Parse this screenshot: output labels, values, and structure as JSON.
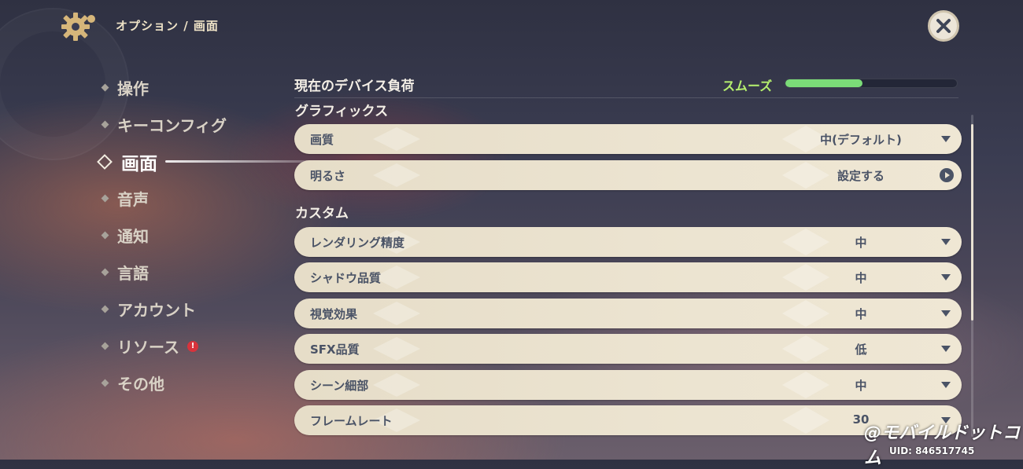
{
  "header": {
    "breadcrumb": "オプション / 画面",
    "settings_icon": "gear-icon",
    "close_icon": "close-icon"
  },
  "sidebar": {
    "items": [
      {
        "label": "操作"
      },
      {
        "label": "キーコンフィグ"
      },
      {
        "label": "画面",
        "active": true
      },
      {
        "label": "音声"
      },
      {
        "label": "通知"
      },
      {
        "label": "言語"
      },
      {
        "label": "アカウント"
      },
      {
        "label": "リソース",
        "alert": "!"
      },
      {
        "label": "その他"
      }
    ]
  },
  "device_load": {
    "title": "現在のデバイス負荷",
    "status": "スムーズ",
    "level": 0.45,
    "status_color": "#b5f06e"
  },
  "sections": {
    "graphics_title": "グラフィックス",
    "custom_title": "カスタム"
  },
  "graphics": [
    {
      "label": "画質",
      "value": "中(デフォルト)",
      "control": "dropdown"
    },
    {
      "label": "明るさ",
      "value": "設定する",
      "control": "go"
    }
  ],
  "custom": [
    {
      "label": "レンダリング精度",
      "value": "中"
    },
    {
      "label": "シャドウ品質",
      "value": "中"
    },
    {
      "label": "視覚効果",
      "value": "中"
    },
    {
      "label": "SFX品質",
      "value": "低"
    },
    {
      "label": "シーン細部",
      "value": "中"
    },
    {
      "label": "フレームレート",
      "value": "30"
    }
  ],
  "footer": {
    "watermark": "@モバイルドットコム",
    "uid": "UID: 846517745"
  },
  "colors": {
    "accent": "#ece5d8",
    "row_text": "#4a5366",
    "load_fill": "#7bdc78"
  }
}
